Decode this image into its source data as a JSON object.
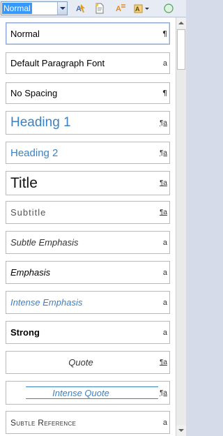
{
  "toolbar": {
    "style_value": "Normal",
    "buttons": [
      {
        "name": "apply-styles-icon"
      },
      {
        "name": "new-style-icon"
      },
      {
        "name": "style-inspector-icon"
      },
      {
        "name": "manage-styles-icon"
      },
      {
        "name": "circle-icon"
      }
    ]
  },
  "styles": [
    {
      "label": "Normal",
      "mark": "¶",
      "kind": "para"
    },
    {
      "label": "Default Paragraph Font",
      "mark": "a",
      "kind": "char"
    },
    {
      "label": "No Spacing",
      "mark": "¶",
      "kind": "para"
    },
    {
      "label": "Heading 1",
      "mark": "¶a",
      "kind": "linked"
    },
    {
      "label": "Heading 2",
      "mark": "¶a",
      "kind": "linked"
    },
    {
      "label": "Title",
      "mark": "¶a",
      "kind": "linked"
    },
    {
      "label": "Subtitle",
      "mark": "¶a",
      "kind": "linked"
    },
    {
      "label": "Subtle Emphasis",
      "mark": "a",
      "kind": "char"
    },
    {
      "label": "Emphasis",
      "mark": "a",
      "kind": "char"
    },
    {
      "label": "Intense Emphasis",
      "mark": "a",
      "kind": "char"
    },
    {
      "label": "Strong",
      "mark": "a",
      "kind": "char"
    },
    {
      "label": "Quote",
      "mark": "¶a",
      "kind": "linked"
    },
    {
      "label": "Intense Quote",
      "mark": "¶a",
      "kind": "linked"
    },
    {
      "label": "Subtle Reference",
      "mark": "a",
      "kind": "char"
    }
  ],
  "colors": {
    "heading_blue": "#3b82c4",
    "selected_border": "#8ea7d1"
  }
}
